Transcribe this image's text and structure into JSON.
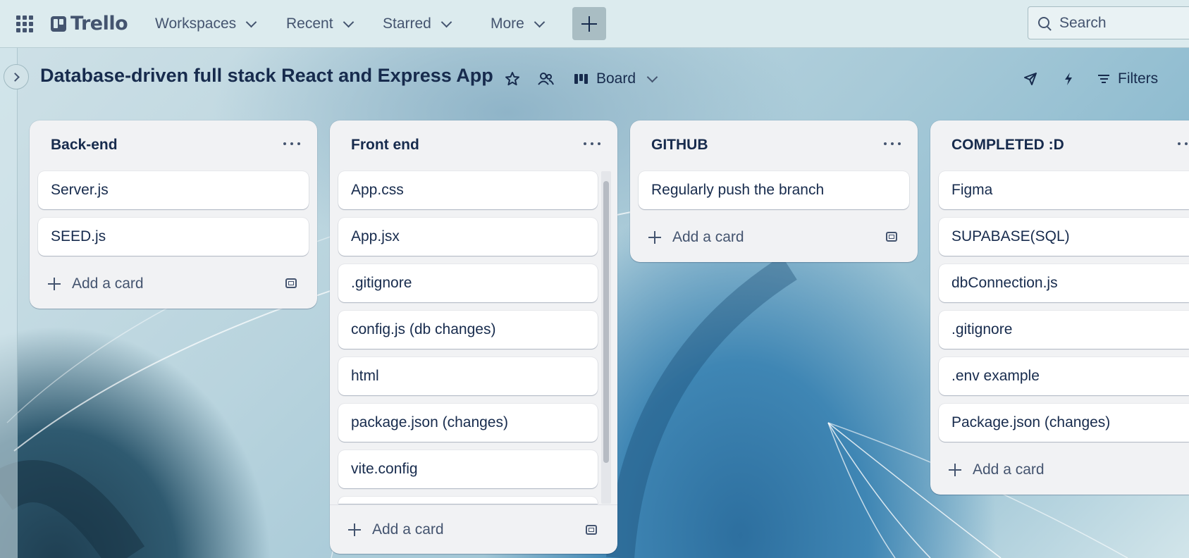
{
  "nav": {
    "logo": "Trello",
    "items": [
      {
        "label": "Workspaces"
      },
      {
        "label": "Recent"
      },
      {
        "label": "Starred"
      },
      {
        "label": "More"
      }
    ],
    "search_placeholder": "Search"
  },
  "board": {
    "title": "Database-driven full stack React and Express App",
    "view_label": "Board",
    "filters_label": "Filters"
  },
  "lists": [
    {
      "title": "Back-end",
      "cards": [
        "Server.js",
        "SEED.js"
      ],
      "add_label": "Add a card"
    },
    {
      "title": "Front end",
      "cards": [
        "App.css",
        "App.jsx",
        ".gitignore",
        "config.js (db changes)",
        "html",
        "package.json (changes)",
        "vite.config"
      ],
      "add_label": "Add a card"
    },
    {
      "title": "GITHUB",
      "cards": [
        "Regularly push the branch"
      ],
      "add_label": "Add a card"
    },
    {
      "title": "COMPLETED :D",
      "cards": [
        "Figma",
        "SUPABASE(SQL)",
        "dbConnection.js",
        ".gitignore",
        ".env example",
        "Package.json (changes)"
      ],
      "add_label": "Add a card"
    }
  ],
  "colors": {
    "topbar_bg": "#dcebee",
    "list_bg": "#f1f2f4",
    "card_bg": "#ffffff",
    "text_primary": "#172b4d",
    "text_secondary": "#44546f"
  },
  "icons": {
    "apps": "grid-icon",
    "create": "plus-icon",
    "search": "search-icon",
    "star": "star-icon",
    "visibility": "workspace-visible-icon",
    "board_view": "board-view-icon",
    "power_ups": "rocket-icon",
    "automation": "lightning-icon",
    "filters": "filter-icon",
    "list_menu": "more-horizontal-icon",
    "add": "plus-icon",
    "template": "card-template-icon"
  }
}
